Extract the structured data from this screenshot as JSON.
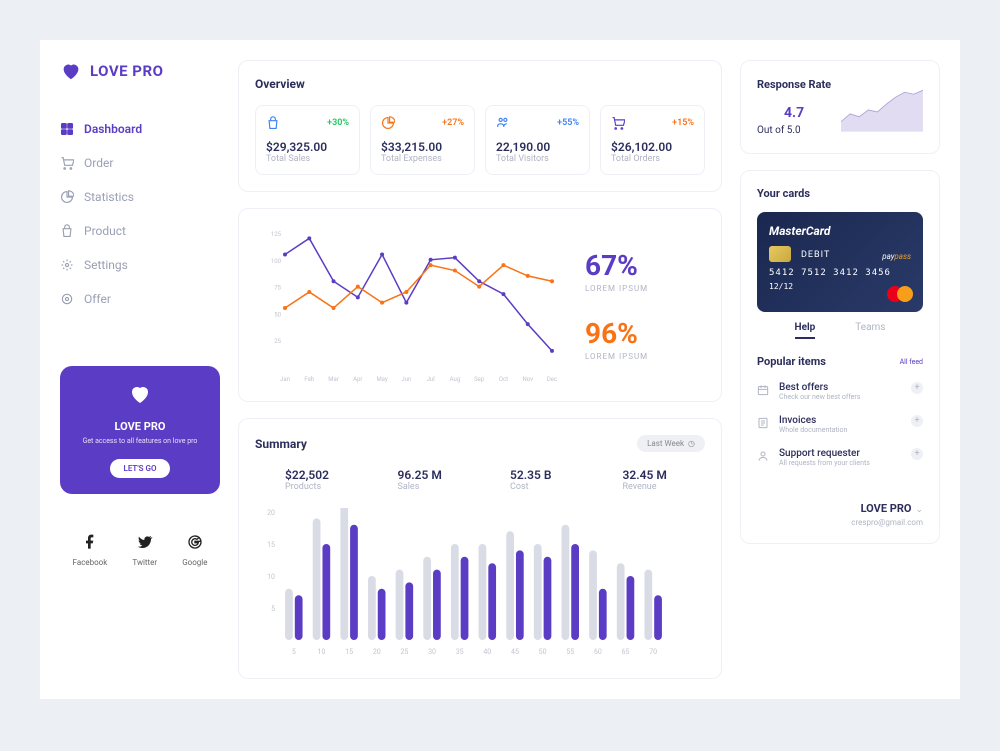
{
  "brand": "LOVE PRO",
  "nav": [
    {
      "label": "Dashboard",
      "icon": "dashboard"
    },
    {
      "label": "Order",
      "icon": "cart"
    },
    {
      "label": "Statistics",
      "icon": "pie"
    },
    {
      "label": "Product",
      "icon": "bag"
    },
    {
      "label": "Settings",
      "icon": "gear"
    },
    {
      "label": "Offer",
      "icon": "target"
    }
  ],
  "promo": {
    "title": "LOVE PRO",
    "sub": "Get access to all features on love pro",
    "btn": "LET'S GO"
  },
  "socials": [
    {
      "label": "Facebook"
    },
    {
      "label": "Twitter"
    },
    {
      "label": "Google"
    }
  ],
  "overview": {
    "title": "Overview",
    "kpis": [
      {
        "delta": "+30%",
        "value": "$29,325.00",
        "label": "Total Sales",
        "color": "#3b82f6",
        "dcolor": "#22c55e"
      },
      {
        "delta": "+27%",
        "value": "$33,215.00",
        "label": "Total Expenses",
        "color": "#f97316",
        "dcolor": "#f97316"
      },
      {
        "delta": "+55%",
        "value": "22,190.00",
        "label": "Total Visitors",
        "color": "#3b82f6",
        "dcolor": "#3b82f6"
      },
      {
        "delta": "+15%",
        "value": "$26,102.00",
        "label": "Total Orders",
        "color": "#5b3cc4",
        "dcolor": "#f97316"
      }
    ]
  },
  "chart": {
    "stats": [
      {
        "value": "67%",
        "label": "LOREM IPSUM",
        "color": "#5b3cc4"
      },
      {
        "value": "96%",
        "label": "LOREM IPSUM",
        "color": "#f97316"
      }
    ]
  },
  "chart_data": {
    "line": {
      "type": "line",
      "categories": [
        "Jan",
        "Feb",
        "Mar",
        "Apr",
        "May",
        "Jun",
        "Jul",
        "Aug",
        "Sep",
        "Oct",
        "Nov",
        "Dec"
      ],
      "ylim": [
        0,
        125
      ],
      "yticks": [
        25,
        50,
        75,
        100,
        125
      ],
      "series": [
        {
          "name": "purple",
          "color": "#5b3cc4",
          "values": [
            105,
            120,
            80,
            65,
            105,
            60,
            100,
            102,
            80,
            68,
            40,
            15
          ]
        },
        {
          "name": "orange",
          "color": "#f97316",
          "values": [
            55,
            70,
            55,
            75,
            60,
            70,
            95,
            90,
            75,
            95,
            85,
            80
          ]
        }
      ]
    },
    "area": {
      "type": "area",
      "x": [
        1,
        2,
        3,
        4,
        5,
        6,
        7,
        8,
        9,
        10
      ],
      "values": [
        10,
        18,
        15,
        22,
        20,
        28,
        35,
        40,
        38,
        42
      ],
      "ylim": [
        0,
        50
      ],
      "color": "#a89cd8"
    },
    "bars": {
      "type": "bar",
      "categories": [
        "5",
        "10",
        "15",
        "20",
        "25",
        "30",
        "35",
        "40",
        "45",
        "50",
        "55",
        "60",
        "65",
        "70"
      ],
      "ylim": [
        0,
        20
      ],
      "yticks": [
        5,
        10,
        15,
        20
      ],
      "series": [
        {
          "name": "bg",
          "color": "#d9dce5",
          "values": [
            8,
            19,
            21,
            10,
            11,
            13,
            15,
            15,
            17,
            15,
            18,
            14,
            12,
            11
          ]
        },
        {
          "name": "fg",
          "color": "#5b3cc4",
          "values": [
            7,
            15,
            18,
            8,
            9,
            11,
            13,
            12,
            14,
            13,
            15,
            8,
            10,
            7
          ]
        }
      ]
    }
  },
  "summary": {
    "title": "Summary",
    "period": "Last Week",
    "metrics": [
      {
        "value": "$22,502",
        "label": "Products"
      },
      {
        "value": "96.25 M",
        "label": "Sales"
      },
      {
        "value": "52.35 B",
        "label": "Cost"
      },
      {
        "value": "32.45 M",
        "label": "Revenue"
      }
    ]
  },
  "response": {
    "title": "Response Rate",
    "score": "4.7",
    "out": "Out of 5.0"
  },
  "cards": {
    "title": "Your cards",
    "brand": "MasterCard",
    "type": "DEBIT",
    "number": "5412 7512 3412 3456",
    "date": "12/12",
    "pay1": "pay",
    "pay2": "pass"
  },
  "tabs": [
    {
      "label": "Help",
      "active": true
    },
    {
      "label": "Teams",
      "active": false
    }
  ],
  "popular": {
    "title": "Popular items",
    "link": "All feed",
    "items": [
      {
        "name": "Best offers",
        "desc": "Check our new best offers"
      },
      {
        "name": "Invoices",
        "desc": "Whole documentation"
      },
      {
        "name": "Support requester",
        "desc": "All requests from your clients"
      }
    ]
  },
  "profile": {
    "name": "LOVE PRO",
    "email": "crespro@gmail.com"
  }
}
